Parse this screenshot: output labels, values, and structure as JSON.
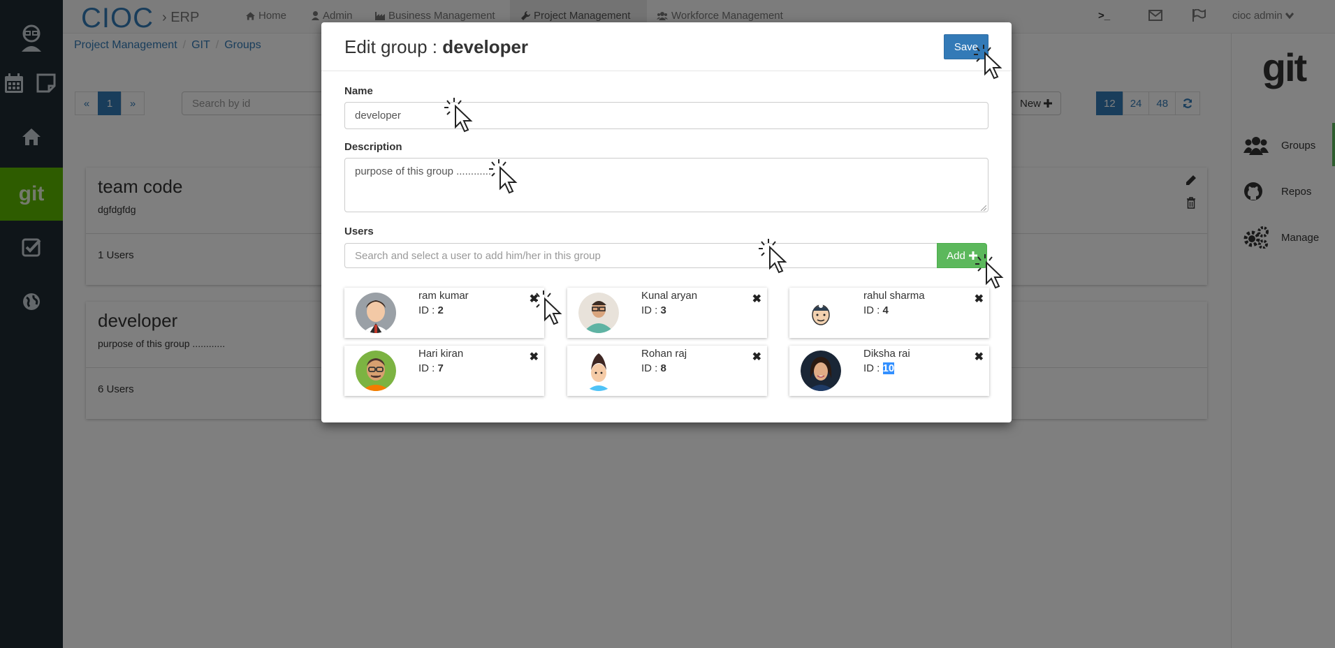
{
  "nav": {
    "brand": "CIOC",
    "brand_sub": "ERP",
    "links": [
      "Home",
      "Admin",
      "Business Management",
      "Project Management",
      "Workforce Management"
    ],
    "user": "cioc admin",
    "terminal": ">_"
  },
  "breadcrumb": [
    "Project Management",
    "GIT",
    "Groups"
  ],
  "toolbar": {
    "prev": "«",
    "page": "1",
    "next": "»",
    "search_placeholder": "Search by id",
    "new_label": "New",
    "page_sizes": [
      "12",
      "24",
      "48"
    ]
  },
  "groups": [
    {
      "title": "team code",
      "description": "dgfdgfdg",
      "users": "1 Users"
    },
    {
      "title": "developer",
      "description": "purpose of this group ............",
      "users": "6 Users"
    }
  ],
  "right_panel": {
    "logo": "git",
    "items": [
      "Groups",
      "Repos",
      "Manage"
    ]
  },
  "left_sidebar": {
    "git_label": "git"
  },
  "modal": {
    "title_prefix": "Edit group : ",
    "title_name": "developer",
    "save_label": "Save",
    "name_label": "Name",
    "name_value": "developer",
    "description_label": "Description",
    "description_value": "purpose of this group ............",
    "users_label": "Users",
    "users_placeholder": "Search and select a user to add him/her in this group",
    "add_label": "Add",
    "id_prefix": "ID : ",
    "close_glyph": "✖",
    "users": [
      {
        "name": "ram kumar",
        "id": "2"
      },
      {
        "name": "Kunal aryan",
        "id": "3"
      },
      {
        "name": "rahul sharma",
        "id": "4"
      },
      {
        "name": "Hari kiran",
        "id": "7"
      },
      {
        "name": "Rohan raj",
        "id": "8"
      },
      {
        "name": "Diksha rai",
        "id": "10"
      }
    ]
  },
  "colors": {
    "accent": "#337ab7",
    "success": "#5cb85c",
    "sidebar_bg": "#1f2a33",
    "git_green": "#5cb800"
  }
}
